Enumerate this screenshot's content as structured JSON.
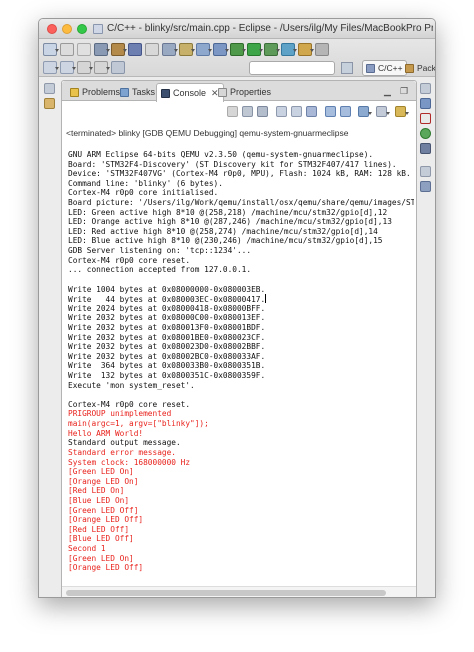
{
  "window": {
    "title": "C/C++ - blinky/src/main.cpp - Eclipse - /Users/ilg/My Files/MacBookPro Project..."
  },
  "perspectives": {
    "cpp_label": "C/C++",
    "packs_label": "Packs"
  },
  "tabs": [
    {
      "label": "Problems",
      "icon": "problems-icon"
    },
    {
      "label": "Tasks",
      "icon": "tasks-icon"
    },
    {
      "label": "Console",
      "icon": "console-icon",
      "active": true
    },
    {
      "label": "Properties",
      "icon": "properties-icon"
    }
  ],
  "console": {
    "terminated_label": "<terminated> blinky [GDB QEMU Debugging] qemu-system-gnuarmeclipse",
    "lines": [
      {
        "text": "GNU ARM Eclipse 64-bits QEMU v2.3.50 (qemu-system-gnuarmeclipse).",
        "stream": "stdout"
      },
      {
        "text": "Board: 'STM32F4-Discovery' (ST Discovery kit for STM32F407/417 lines).",
        "stream": "stdout"
      },
      {
        "text": "Device: 'STM32F407VG' (Cortex-M4 r0p0, MPU), Flash: 1024 kB, RAM: 128 kB.",
        "stream": "stdout"
      },
      {
        "text": "Command line: 'blinky' (6 bytes).",
        "stream": "stdout"
      },
      {
        "text": "Cortex-M4 r0p0 core initialised.",
        "stream": "stdout"
      },
      {
        "text": "Board picture: '/Users/ilg/Work/qemu/install/osx/qemu/share/qemu/images/STM",
        "stream": "stdout"
      },
      {
        "text": "LED: Green active high 8*10 @(258,218) /machine/mcu/stm32/gpio[d],12",
        "stream": "stdout"
      },
      {
        "text": "LED: Orange active high 8*10 @(287,246) /machine/mcu/stm32/gpio[d],13",
        "stream": "stdout"
      },
      {
        "text": "LED: Red active high 8*10 @(258,274) /machine/mcu/stm32/gpio[d],14",
        "stream": "stdout"
      },
      {
        "text": "LED: Blue active high 8*10 @(230,246) /machine/mcu/stm32/gpio[d],15",
        "stream": "stdout"
      },
      {
        "text": "GDB Server listening on: 'tcp::1234'...",
        "stream": "stdout"
      },
      {
        "text": "Cortex-M4 r0p0 core reset.",
        "stream": "stdout"
      },
      {
        "text": "... connection accepted from 127.0.0.1.",
        "stream": "stdout"
      },
      {
        "text": "",
        "stream": "stdout"
      },
      {
        "text": "Write 1004 bytes at 0x08000000-0x080003EB.",
        "stream": "stdout"
      },
      {
        "text": "Write   44 bytes at 0x080003EC-0x08000417.",
        "stream": "stdout",
        "cursor": true
      },
      {
        "text": "Write 2024 bytes at 0x08000418-0x08000BFF.",
        "stream": "stdout"
      },
      {
        "text": "Write 2032 bytes at 0x08000C00-0x080013EF.",
        "stream": "stdout"
      },
      {
        "text": "Write 2032 bytes at 0x080013F0-0x08001BDF.",
        "stream": "stdout"
      },
      {
        "text": "Write 2032 bytes at 0x08001BE0-0x080023CF.",
        "stream": "stdout"
      },
      {
        "text": "Write 2032 bytes at 0x080023D0-0x08002BBF.",
        "stream": "stdout"
      },
      {
        "text": "Write 2032 bytes at 0x08002BC0-0x080033AF.",
        "stream": "stdout"
      },
      {
        "text": "Write  364 bytes at 0x080033B0-0x0800351B.",
        "stream": "stdout"
      },
      {
        "text": "Write  132 bytes at 0x0800351C-0x0800359F.",
        "stream": "stdout"
      },
      {
        "text": "Execute 'mon system_reset'.",
        "stream": "stdout"
      },
      {
        "text": "",
        "stream": "stdout"
      },
      {
        "text": "Cortex-M4 r0p0 core reset.",
        "stream": "stdout"
      },
      {
        "text": "PRIGROUP unimplemented",
        "stream": "stderr"
      },
      {
        "text": "main(argc=1, argv=[\"blinky\"]);",
        "stream": "stderr"
      },
      {
        "text": "Hello ARM World!",
        "stream": "stderr"
      },
      {
        "text": "Standard output message.",
        "stream": "stdout"
      },
      {
        "text": "Standard error message.",
        "stream": "stderr"
      },
      {
        "text": "System clock: 168000000 Hz",
        "stream": "stderr"
      },
      {
        "text": "[Green LED On]",
        "stream": "stderr"
      },
      {
        "text": "[Orange LED On]",
        "stream": "stderr"
      },
      {
        "text": "[Red LED On]",
        "stream": "stderr"
      },
      {
        "text": "[Blue LED On]",
        "stream": "stderr"
      },
      {
        "text": "[Green LED Off]",
        "stream": "stderr"
      },
      {
        "text": "[Orange LED Off]",
        "stream": "stderr"
      },
      {
        "text": "[Red LED Off]",
        "stream": "stderr"
      },
      {
        "text": "[Blue LED Off]",
        "stream": "stderr"
      },
      {
        "text": "Second 1",
        "stream": "stderr"
      },
      {
        "text": "[Green LED On]",
        "stream": "stderr"
      },
      {
        "text": "[Orange LED Off]",
        "stream": "stderr"
      }
    ]
  },
  "colors": {
    "stderr": "#e8221c",
    "stdout": "#111111",
    "close": "#fc605c",
    "minimize": "#fdbc40",
    "zoom": "#34c84a"
  }
}
